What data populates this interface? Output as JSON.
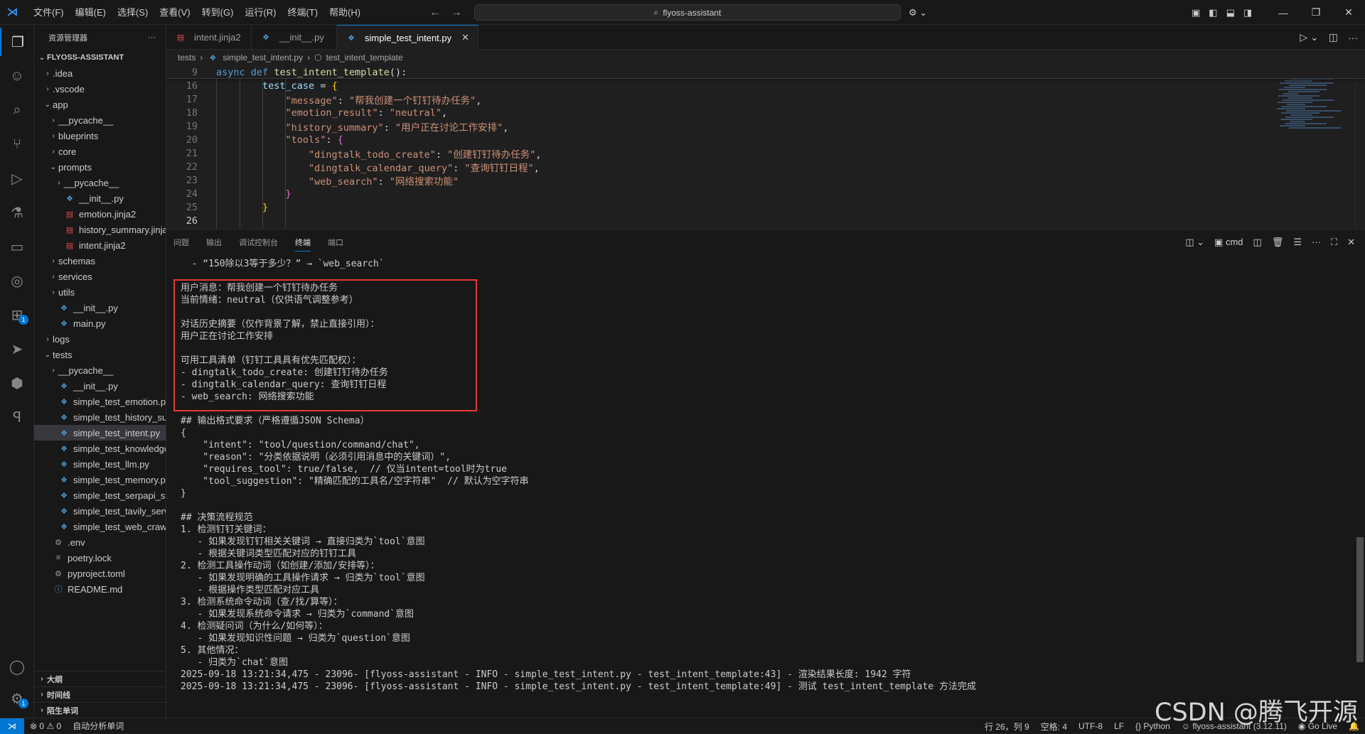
{
  "titlebar": {
    "menu": [
      "文件(F)",
      "编辑(E)",
      "选择(S)",
      "查看(V)",
      "转到(G)",
      "运行(R)",
      "终端(T)",
      "帮助(H)"
    ],
    "search_text": "flyoss-assistant"
  },
  "sidebar": {
    "title": "资源管理器",
    "root": "FLYOSS-ASSISTANT",
    "tree": [
      {
        "label": ".idea",
        "type": "folder",
        "depth": 1,
        "open": false
      },
      {
        "label": ".vscode",
        "type": "folder",
        "depth": 1,
        "open": false
      },
      {
        "label": "app",
        "type": "folder",
        "depth": 1,
        "open": true
      },
      {
        "label": "__pycache__",
        "type": "folder",
        "depth": 2,
        "open": false
      },
      {
        "label": "blueprints",
        "type": "folder",
        "depth": 2,
        "open": false
      },
      {
        "label": "core",
        "type": "folder",
        "depth": 2,
        "open": false
      },
      {
        "label": "prompts",
        "type": "folder",
        "depth": 2,
        "open": true
      },
      {
        "label": "__pycache__",
        "type": "folder",
        "depth": 3,
        "open": false
      },
      {
        "label": "__init__.py",
        "type": "py",
        "depth": 3
      },
      {
        "label": "emotion.jinja2",
        "type": "jinja",
        "depth": 3
      },
      {
        "label": "history_summary.jinja2",
        "type": "jinja",
        "depth": 3
      },
      {
        "label": "intent.jinja2",
        "type": "jinja",
        "depth": 3
      },
      {
        "label": "schemas",
        "type": "folder",
        "depth": 2,
        "open": false
      },
      {
        "label": "services",
        "type": "folder",
        "depth": 2,
        "open": false
      },
      {
        "label": "utils",
        "type": "folder",
        "depth": 2,
        "open": false
      },
      {
        "label": "__init__.py",
        "type": "py",
        "depth": 2
      },
      {
        "label": "main.py",
        "type": "py",
        "depth": 2
      },
      {
        "label": "logs",
        "type": "folder",
        "depth": 1,
        "open": false
      },
      {
        "label": "tests",
        "type": "folder",
        "depth": 1,
        "open": true
      },
      {
        "label": "__pycache__",
        "type": "folder",
        "depth": 2,
        "open": false
      },
      {
        "label": "__init__.py",
        "type": "py",
        "depth": 2
      },
      {
        "label": "simple_test_emotion.py",
        "type": "py",
        "depth": 2
      },
      {
        "label": "simple_test_history_su...",
        "type": "py",
        "depth": 2
      },
      {
        "label": "simple_test_intent.py",
        "type": "py",
        "depth": 2,
        "selected": true
      },
      {
        "label": "simple_test_knowledge...",
        "type": "py",
        "depth": 2
      },
      {
        "label": "simple_test_llm.py",
        "type": "py",
        "depth": 2
      },
      {
        "label": "simple_test_memory.py",
        "type": "py",
        "depth": 2
      },
      {
        "label": "simple_test_serpapi_se...",
        "type": "py",
        "depth": 2
      },
      {
        "label": "simple_test_tavily_servi...",
        "type": "py",
        "depth": 2
      },
      {
        "label": "simple_test_web_crawl...",
        "type": "py",
        "depth": 2
      },
      {
        "label": ".env",
        "type": "cfg",
        "depth": 1
      },
      {
        "label": "poetry.lock",
        "type": "lock",
        "depth": 1
      },
      {
        "label": "pyproject.toml",
        "type": "cfg",
        "depth": 1
      },
      {
        "label": "README.md",
        "type": "info",
        "depth": 1
      }
    ],
    "sections": [
      "大纲",
      "时间线",
      "陌生单词"
    ]
  },
  "editor": {
    "tabs": [
      {
        "label": "intent.jinja2",
        "icon": "jinja",
        "active": false
      },
      {
        "label": "__init__.py",
        "icon": "py",
        "active": false
      },
      {
        "label": "simple_test_intent.py",
        "icon": "py",
        "active": true
      }
    ],
    "breadcrumb": [
      "tests",
      "simple_test_intent.py",
      "test_intent_template"
    ],
    "sticky": {
      "ln": "9",
      "kw1": "async",
      "kw2": "def",
      "fn": "test_intent_template",
      "rest": "():"
    },
    "lines": [
      {
        "ln": "16",
        "indent": "        ",
        "parts": [
          [
            "k-var",
            "test_case"
          ],
          [
            "k-w",
            " = "
          ],
          [
            "k-p1",
            "{"
          ]
        ]
      },
      {
        "ln": "17",
        "indent": "            ",
        "parts": [
          [
            "k-str",
            "\"message\""
          ],
          [
            "k-w",
            ": "
          ],
          [
            "k-str",
            "\"帮我创建一个钉钉待办任务\""
          ],
          [
            "k-w",
            ","
          ]
        ]
      },
      {
        "ln": "18",
        "indent": "            ",
        "parts": [
          [
            "k-str",
            "\"emotion_result\""
          ],
          [
            "k-w",
            ": "
          ],
          [
            "k-str",
            "\"neutral\""
          ],
          [
            "k-w",
            ","
          ]
        ]
      },
      {
        "ln": "19",
        "indent": "            ",
        "parts": [
          [
            "k-str",
            "\"history_summary\""
          ],
          [
            "k-w",
            ": "
          ],
          [
            "k-str",
            "\"用户正在讨论工作安排\""
          ],
          [
            "k-w",
            ","
          ]
        ]
      },
      {
        "ln": "20",
        "indent": "            ",
        "parts": [
          [
            "k-str",
            "\"tools\""
          ],
          [
            "k-w",
            ": "
          ],
          [
            "k-p2",
            "{"
          ]
        ]
      },
      {
        "ln": "21",
        "indent": "                ",
        "parts": [
          [
            "k-str",
            "\"dingtalk_todo_create\""
          ],
          [
            "k-w",
            ": "
          ],
          [
            "k-str",
            "\"创建钉钉待办任务\""
          ],
          [
            "k-w",
            ","
          ]
        ]
      },
      {
        "ln": "22",
        "indent": "                ",
        "parts": [
          [
            "k-str",
            "\"dingtalk_calendar_query\""
          ],
          [
            "k-w",
            ": "
          ],
          [
            "k-str",
            "\"查询钉钉日程\""
          ],
          [
            "k-w",
            ","
          ]
        ]
      },
      {
        "ln": "23",
        "indent": "                ",
        "parts": [
          [
            "k-str",
            "\"web_search\""
          ],
          [
            "k-w",
            ": "
          ],
          [
            "k-str",
            "\"网络搜索功能\""
          ]
        ]
      },
      {
        "ln": "24",
        "indent": "            ",
        "parts": [
          [
            "k-p2",
            "}"
          ]
        ]
      },
      {
        "ln": "25",
        "indent": "        ",
        "parts": [
          [
            "k-p1",
            "}"
          ]
        ]
      },
      {
        "ln": "26",
        "indent": "",
        "parts": [],
        "current": true
      }
    ]
  },
  "panel": {
    "tabs": [
      "问题",
      "输出",
      "调试控制台",
      "终端",
      "端口"
    ],
    "active_tab": "终端",
    "shell": "cmd",
    "terminal_lines": [
      "  - “150除以3等于多少？” → `web_search`",
      "",
      "用户消息：帮我创建一个钉钉待办任务",
      "当前情绪：neutral（仅供语气调整参考）",
      "",
      "对话历史摘要（仅作背景了解，禁止直接引用）：",
      "用户正在讨论工作安排",
      "",
      "可用工具清单（钉钉工具具有优先匹配权）：",
      "- dingtalk_todo_create: 创建钉钉待办任务",
      "- dingtalk_calendar_query: 查询钉钉日程",
      "- web_search: 网络搜索功能",
      "",
      "## 输出格式要求（严格遵循JSON Schema）",
      "{",
      "    \"intent\": \"tool/question/command/chat\",",
      "    \"reason\": \"分类依据说明（必须引用消息中的关键词）\",",
      "    \"requires_tool\": true/false,  // 仅当intent=tool时为true",
      "    \"tool_suggestion\": \"精确匹配的工具名/空字符串\"  // 默认为空字符串",
      "}",
      "",
      "## 决策流程规范",
      "1. 检测钉钉关键词：",
      "   - 如果发现钉钉相关关键词 → 直接归类为`tool`意图",
      "   - 根据关键词类型匹配对应的钉钉工具",
      "2. 检测工具操作动词（如创建/添加/安排等）：",
      "   - 如果发现明确的工具操作请求 → 归类为`tool`意图",
      "   - 根据操作类型匹配对应工具",
      "3. 检测系统命令动词（查/找/算等）：",
      "   - 如果发现系统命令请求 → 归类为`command`意图",
      "4. 检测疑问词（为什么/如何等）：",
      "   - 如果发现知识性问题 → 归类为`question`意图",
      "5. 其他情况：",
      "   - 归类为`chat`意图",
      "2025-09-18 13:21:34,475 - 23096- [flyoss-assistant - INFO - simple_test_intent.py - test_intent_template:43] - 渲染结果长度: 1942 字符",
      "2025-09-18 13:21:34,475 - 23096- [flyoss-assistant - INFO - simple_test_intent.py - test_intent_template:49] - 测试 test_intent_template 方法完成"
    ]
  },
  "statusbar": {
    "errors": "0",
    "warnings": "0",
    "auto_analysis": "自动分析单词",
    "position": "行 26，列 9",
    "spaces": "空格: 4",
    "encoding": "UTF-8",
    "eol": "LF",
    "language": "Python",
    "interpreter": "flyoss-assistant (3.12.11)",
    "golive": "Go Live"
  },
  "watermark": "CSDN @腾飞开源",
  "colors": {
    "accent": "#0078d4",
    "highlight_box": "#e53935"
  }
}
